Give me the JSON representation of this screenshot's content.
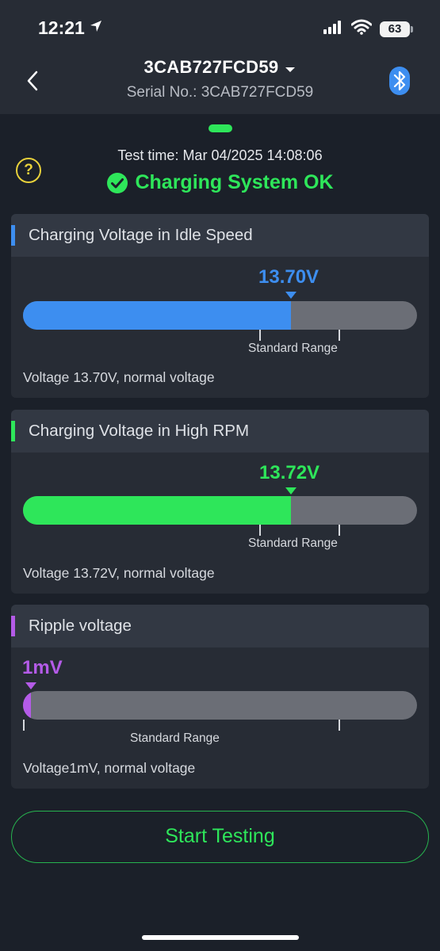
{
  "status_bar": {
    "time": "12:21",
    "battery": "63"
  },
  "header": {
    "device_id": "3CAB727FCD59",
    "serial": "Serial No.: 3CAB727FCD59"
  },
  "test": {
    "time": "Test time: Mar 04/2025 14:08:06",
    "status": "Charging System OK"
  },
  "cards": [
    {
      "title": "Charging Voltage in Idle Speed",
      "value": "13.70V",
      "level": 0.68,
      "range_label": "Standard Range",
      "description": "Voltage 13.70V, normal voltage",
      "accent": "#3d8ef0"
    },
    {
      "title": "Charging Voltage in High RPM",
      "value": "13.72V",
      "level": 0.68,
      "range_label": "Standard Range",
      "description": "Voltage 13.72V, normal voltage",
      "accent": "#2ee65a"
    },
    {
      "title": "Ripple voltage",
      "value": "1mV",
      "level": 0.02,
      "range_label": "Standard Range",
      "description": "Voltage1mV, normal voltage",
      "accent": "#b45be8"
    }
  ],
  "actions": {
    "start": "Start Testing"
  },
  "colors": {
    "background": "#1b2029",
    "card": "#272c35",
    "ok": "#2ee65a",
    "track": "#6b6e76"
  },
  "icons": [
    "location-arrow-icon",
    "signal-icon",
    "wifi-icon",
    "battery-icon",
    "back-icon",
    "chevron-down-icon",
    "bluetooth-icon",
    "help-icon",
    "check-circle-icon"
  ]
}
